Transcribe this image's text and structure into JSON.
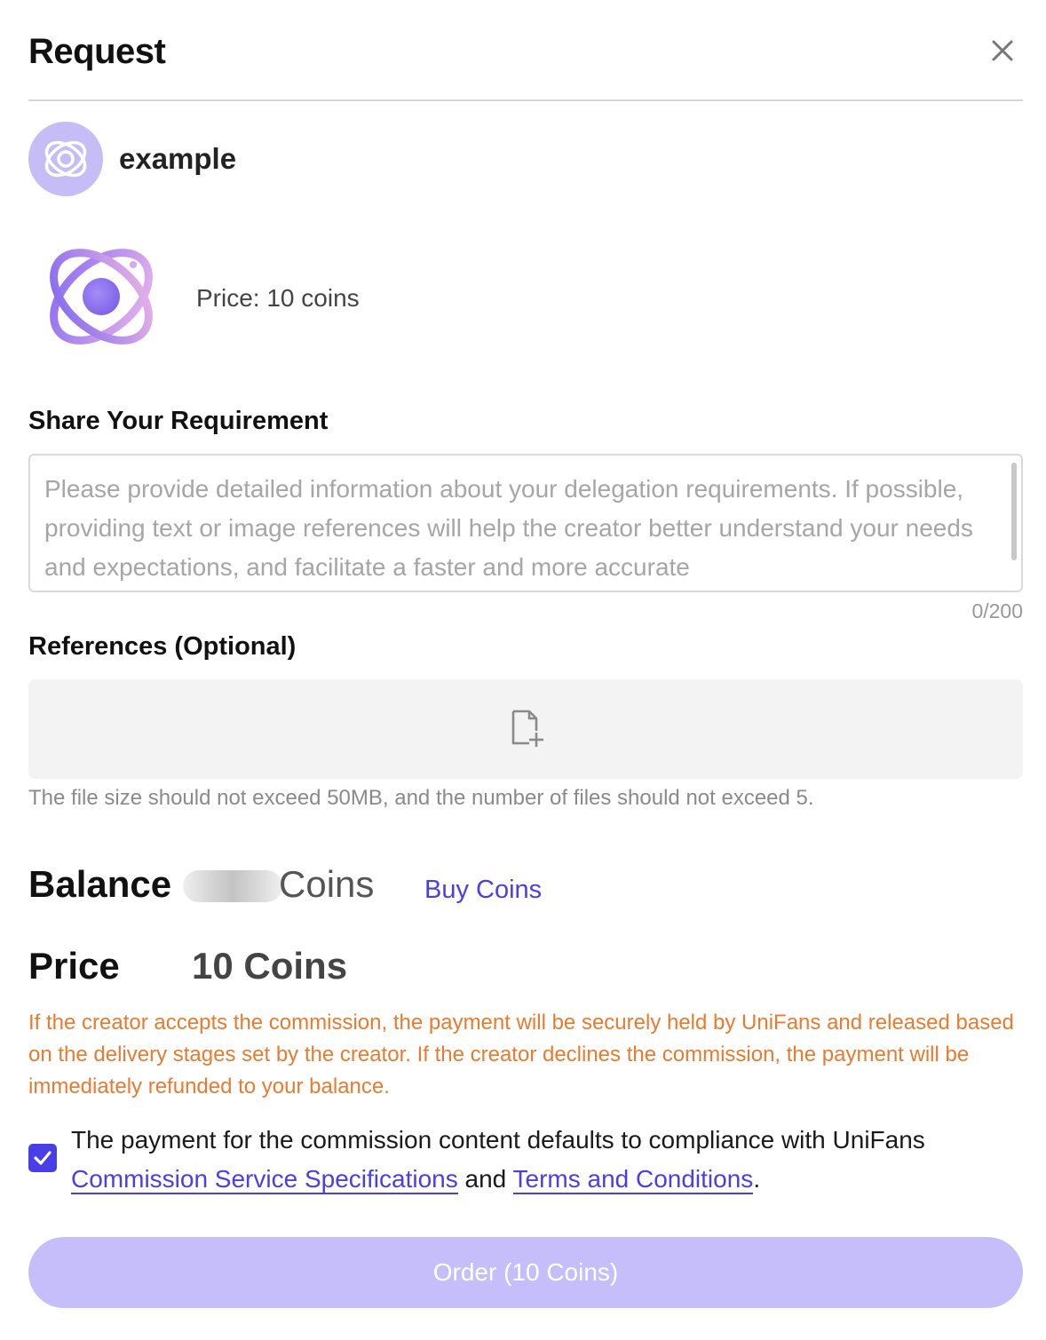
{
  "dialog": {
    "title": "Request"
  },
  "creator": {
    "name": "example"
  },
  "product": {
    "price_text": "Price: 10 coins"
  },
  "requirement": {
    "label": "Share Your Requirement",
    "value": "",
    "placeholder": "Please provide detailed information about your delegation requirements. If possible, providing text or image references will help the creator better understand your needs and expectations, and facilitate a faster and more accurate",
    "counter": "0/200"
  },
  "references": {
    "label": "References (Optional)",
    "hint": "The file size should not exceed 50MB, and the number of files should not exceed 5."
  },
  "balance": {
    "label": "Balance",
    "unit": "Coins",
    "buy_label": "Buy Coins"
  },
  "price": {
    "label": "Price",
    "value": "10 Coins"
  },
  "notice": "If the creator accepts the commission, the payment will be securely held by UniFans and released based on the delivery stages set by the creator. If the creator declines the commission, the payment will be immediately refunded to your balance.",
  "agreement": {
    "checked": true,
    "prefix": "The payment for the commission content defaults to compliance with UniFans ",
    "link1": "Commission Service Specifications",
    "middle": " and ",
    "link2": "Terms and Conditions",
    "suffix": "."
  },
  "order_button": "Order (10 Coins)",
  "colors": {
    "accent": "#4a3fe6",
    "notice": "#e87b2f",
    "button": "#c5befa",
    "avatar_bg": "#c6bdf6"
  },
  "icons": {
    "close": "close-icon",
    "avatar": "atom-logo-icon",
    "product": "atom-logo-icon",
    "upload": "file-add-icon",
    "check": "check-icon"
  }
}
